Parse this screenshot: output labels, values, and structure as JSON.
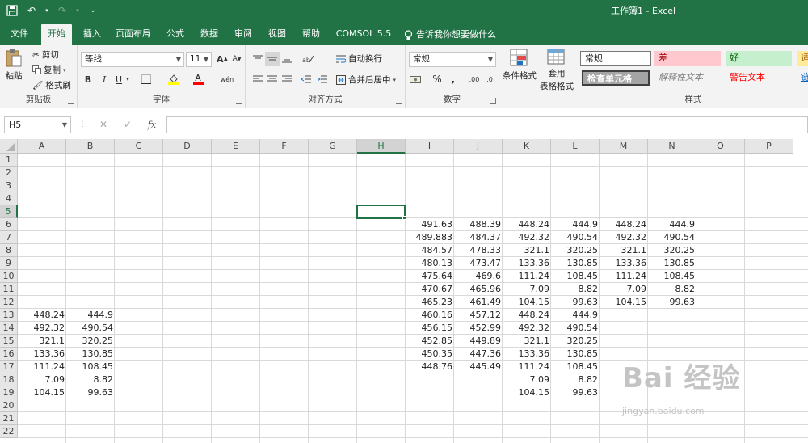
{
  "window": {
    "title": "工作簿1  -  Excel"
  },
  "quick_access": {
    "save_icon": "save-icon",
    "undo_icon": "undo-icon",
    "redo_icon": "redo-icon",
    "customize_icon": "customize-qat-icon"
  },
  "tabs": [
    {
      "label": "文件"
    },
    {
      "label": "开始"
    },
    {
      "label": "插入"
    },
    {
      "label": "页面布局"
    },
    {
      "label": "公式"
    },
    {
      "label": "数据"
    },
    {
      "label": "审阅"
    },
    {
      "label": "视图"
    },
    {
      "label": "帮助"
    },
    {
      "label": "COMSOL 5.5"
    }
  ],
  "tell_me": {
    "label": "告诉我你想要做什么"
  },
  "ribbon": {
    "clipboard": {
      "label": "剪贴板",
      "paste": "粘贴",
      "cut": "剪切",
      "copy": "复制",
      "format_painter": "格式刷"
    },
    "font": {
      "label": "字体",
      "font_name": "等线",
      "font_size": "11",
      "bold": "B",
      "italic": "I",
      "underline": "U",
      "grow": "A",
      "shrink": "A",
      "font_color": "A",
      "phonetic": "wén"
    },
    "alignment": {
      "label": "对齐方式",
      "wrap": "自动换行",
      "merge": "合并后居中"
    },
    "number": {
      "label": "数字",
      "format": "常规",
      "percent": "%",
      "comma": ",",
      "inc_dec": ".00",
      "dec_dec": ".0"
    },
    "cond_format": {
      "label": "条件格式"
    },
    "table_format": {
      "line1": "套用",
      "line2": "表格格式"
    },
    "styles": {
      "label": "样式",
      "normal": "常规",
      "bad": "差",
      "good": "好",
      "neutral": "适",
      "check": "检查单元格",
      "explanatory": "解释性文本",
      "warning": "警告文本",
      "link": "链"
    }
  },
  "formula_bar": {
    "name_box": "H5",
    "fx": "fx",
    "value": ""
  },
  "columns": [
    "A",
    "B",
    "C",
    "D",
    "E",
    "F",
    "G",
    "H",
    "I",
    "J",
    "K",
    "L",
    "M",
    "N",
    "O",
    "P"
  ],
  "rows": [
    "1",
    "2",
    "3",
    "4",
    "5",
    "6",
    "7",
    "8",
    "9",
    "10",
    "11",
    "12",
    "13",
    "14",
    "15",
    "16",
    "17",
    "18",
    "19",
    "20",
    "21",
    "22"
  ],
  "selected_cell": "H5",
  "cells": {
    "A": {
      "13": "448.24",
      "14": "492.32",
      "15": "321.1",
      "16": "133.36",
      "17": "111.24",
      "18": "7.09",
      "19": "104.15"
    },
    "B": {
      "13": "444.9",
      "14": "490.54",
      "15": "320.25",
      "16": "130.85",
      "17": "108.45",
      "18": "8.82",
      "19": "99.63"
    },
    "I": {
      "6": "491.63",
      "7": "489.883",
      "8": "484.57",
      "9": "480.13",
      "10": "475.64",
      "11": "470.67",
      "12": "465.23",
      "13": "460.16",
      "14": "456.15",
      "15": "452.85",
      "16": "450.35",
      "17": "448.76"
    },
    "J": {
      "6": "488.39",
      "7": "484.37",
      "8": "478.33",
      "9": "473.47",
      "10": "469.6",
      "11": "465.96",
      "12": "461.49",
      "13": "457.12",
      "14": "452.99",
      "15": "449.89",
      "16": "447.36",
      "17": "445.49"
    },
    "K": {
      "6": "448.24",
      "7": "492.32",
      "8": "321.1",
      "9": "133.36",
      "10": "111.24",
      "11": "7.09",
      "12": "104.15",
      "13": "448.24",
      "14": "492.32",
      "15": "321.1",
      "16": "133.36",
      "17": "111.24",
      "18": "7.09",
      "19": "104.15"
    },
    "L": {
      "6": "444.9",
      "7": "490.54",
      "8": "320.25",
      "9": "130.85",
      "10": "108.45",
      "11": "8.82",
      "12": "99.63",
      "13": "444.9",
      "14": "490.54",
      "15": "320.25",
      "16": "130.85",
      "17": "108.45",
      "18": "8.82",
      "19": "99.63"
    },
    "M": {
      "6": "448.24",
      "7": "492.32",
      "8": "321.1",
      "9": "133.36",
      "10": "111.24",
      "11": "7.09",
      "12": "104.15"
    },
    "N": {
      "6": "444.9",
      "7": "490.54",
      "8": "320.25",
      "9": "130.85",
      "10": "108.45",
      "11": "8.82",
      "12": "99.63"
    }
  },
  "watermark": {
    "brand": "Bai 经验",
    "url": "jingyan.baidu.com"
  },
  "colors": {
    "accent": "#217346",
    "bad_bg": "#ffc7ce",
    "bad_fg": "#9c0006",
    "good_bg": "#c6efce",
    "good_fg": "#006100",
    "neutral_bg": "#ffeb9c"
  }
}
